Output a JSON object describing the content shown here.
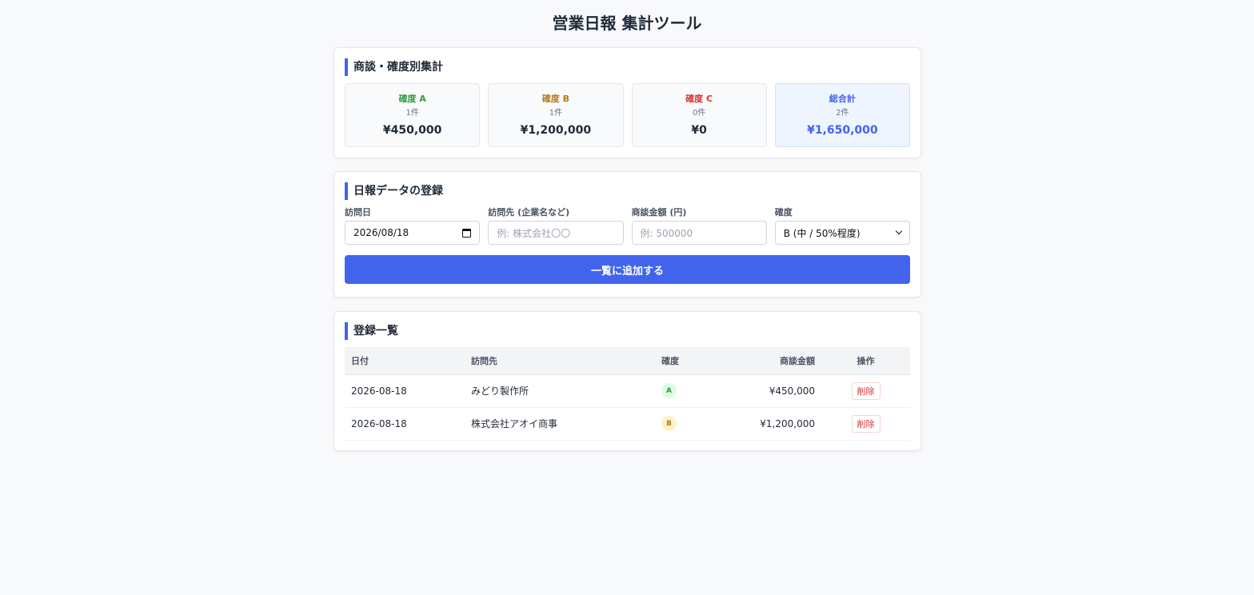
{
  "page": {
    "title": "営業日報 集計ツール"
  },
  "summary": {
    "title": "商談・確度別集計",
    "boxes": [
      {
        "label": "確度 A",
        "count": "1件",
        "amount": "¥450,000",
        "color": "#2f9e44"
      },
      {
        "label": "確度 B",
        "count": "1件",
        "amount": "¥1,200,000",
        "color": "#b7791f"
      },
      {
        "label": "確度 C",
        "count": "0件",
        "amount": "¥0",
        "color": "#e03131"
      },
      {
        "label": "総合計",
        "count": "2件",
        "amount": "¥1,650,000",
        "color": "#4263eb"
      }
    ]
  },
  "form": {
    "title": "日報データの登録",
    "date_label": "訪問日",
    "date_value": "2026/08/18",
    "dest_label": "訪問先 (企業名など)",
    "dest_placeholder": "例: 株式会社〇〇",
    "amount_label": "商談金額 (円)",
    "amount_placeholder": "例: 500000",
    "conf_label": "確度",
    "conf_value": "B (中 / 50%程度)",
    "submit_label": "一覧に追加する"
  },
  "list": {
    "title": "登録一覧",
    "headers": {
      "date": "日付",
      "dest": "訪問先",
      "conf": "確度",
      "amount": "商談金額",
      "op": "操作"
    },
    "rows": [
      {
        "date": "2026-08-18",
        "dest": "みどり製作所",
        "conf": "A",
        "amount": "¥450,000",
        "delete": "削除"
      },
      {
        "date": "2026-08-18",
        "dest": "株式会社アオイ商事",
        "conf": "B",
        "amount": "¥1,200,000",
        "delete": "削除"
      }
    ]
  },
  "colors": {
    "accent": "#4263eb",
    "danger": "#e03131"
  }
}
